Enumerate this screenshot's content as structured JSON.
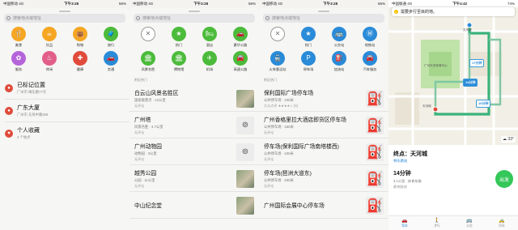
{
  "panel1": {
    "status": {
      "left": "中国移动 4G",
      "time": "下午3:28",
      "right": "56%"
    },
    "search_placeholder": "搜索地点或地址",
    "categories": [
      {
        "label": "美食",
        "icon": "fork-knife-icon",
        "glyph": "🍴",
        "color": "#f5a623"
      },
      {
        "label": "饮品",
        "icon": "coffee-cup-icon",
        "glyph": "☕",
        "color": "#f5a623"
      },
      {
        "label": "购物",
        "icon": "shopping-bag-icon",
        "glyph": "👜",
        "color": "#f5a623"
      },
      {
        "label": "旅行",
        "icon": "suitcase-icon",
        "glyph": "🧳",
        "color": "#4cbb3b"
      },
      {
        "label": "服务",
        "icon": "service-icon",
        "glyph": "✿",
        "color": "#b565d9"
      },
      {
        "label": "休闲",
        "icon": "leisure-icon",
        "glyph": "♨",
        "color": "#e25f8a"
      },
      {
        "label": "健康",
        "icon": "health-icon",
        "glyph": "✚",
        "color": "#e04b3b"
      },
      {
        "label": "交通",
        "icon": "transit-icon",
        "glyph": "🚗",
        "color": "#2a8bd8"
      }
    ],
    "favorites": [
      {
        "title": "已标记位置",
        "subtitle": "广州市 梅东路77号",
        "icon": "pin-icon",
        "glyph": "●"
      },
      {
        "title": "广东大厦",
        "subtitle": "广州市 东风中路309",
        "icon": "pin-icon",
        "glyph": "●"
      },
      {
        "title": "个人收藏",
        "subtitle": "2 个地点",
        "icon": "heart-icon",
        "glyph": "♥"
      }
    ]
  },
  "panel2": {
    "status": {
      "left": "中国移动 4G",
      "time": "下午3:28",
      "right": "56%"
    },
    "search_placeholder": "搜索地点或地址",
    "categories": [
      {
        "label": "",
        "icon": "close-icon",
        "glyph": "✕",
        "color": "#4cbb3b",
        "outline": true
      },
      {
        "label": "热门",
        "icon": "star-icon",
        "glyph": "★",
        "color": "#4cbb3b"
      },
      {
        "label": "酒店",
        "icon": "bed-icon",
        "glyph": "🛏",
        "color": "#4cbb3b"
      },
      {
        "label": "豪华公路",
        "icon": "car-icon",
        "glyph": "🚗",
        "color": "#4cbb3b"
      },
      {
        "label": "风景名胜",
        "icon": "landmark-icon",
        "glyph": "🏛",
        "color": "#4cbb3b"
      },
      {
        "label": "博物馆",
        "icon": "museum-icon",
        "glyph": "🏛",
        "color": "#4cbb3b"
      },
      {
        "label": "机场",
        "icon": "airplane-icon",
        "glyph": "✈",
        "color": "#4cbb3b"
      },
      {
        "label": "高速公路",
        "icon": "highway-icon",
        "glyph": "🚘",
        "color": "#4cbb3b"
      }
    ],
    "section_title": "附近热门",
    "results": [
      {
        "title": "白云山风景名胜区",
        "subtitle": "国家级景点 · 12公里",
        "rating": "无评论",
        "thumb": "photo"
      },
      {
        "title": "广州塔",
        "subtitle": "风景名胜 · 4.7公里",
        "rating": "无评论",
        "thumb": "bino"
      },
      {
        "title": "广州动物园",
        "subtitle": "动物园 · 3公里",
        "rating": "无评论",
        "thumb": "bino"
      },
      {
        "title": "越秀公园",
        "subtitle": "公园 · 11公里",
        "rating": "无评论",
        "thumb": "photo"
      },
      {
        "title": "中山纪念堂",
        "subtitle": "",
        "rating": "",
        "thumb": "photo"
      }
    ]
  },
  "panel3": {
    "status": {
      "left": "中国移动 4G",
      "time": "下午3:28",
      "right": "56%"
    },
    "search_placeholder": "搜索地点或地址",
    "categories": [
      {
        "label": "",
        "icon": "close-icon",
        "glyph": "✕",
        "color": "#2a8bd8",
        "outline": true
      },
      {
        "label": "热门",
        "icon": "star-icon",
        "glyph": "★",
        "color": "#2a8bd8"
      },
      {
        "label": "公交站",
        "icon": "bus-icon",
        "glyph": "🚌",
        "color": "#2a8bd8"
      },
      {
        "label": "地铁站",
        "icon": "metro-icon",
        "glyph": "Ⓜ",
        "color": "#2a8bd8"
      },
      {
        "label": "火车客运站",
        "icon": "train-icon",
        "glyph": "🚆",
        "color": "#2a8bd8"
      },
      {
        "label": "停车场",
        "icon": "parking-icon",
        "glyph": "P",
        "color": "#2a8bd8"
      },
      {
        "label": "加油站",
        "icon": "fuel-icon",
        "glyph": "⛽",
        "color": "#2a8bd8"
      },
      {
        "label": "汽车服务",
        "icon": "car-service-icon",
        "glyph": "🚘",
        "color": "#2a8bd8"
      }
    ],
    "section_title": "附近热门",
    "results": [
      {
        "title": "保利国际广场停车场",
        "subtitle": "公共停车场 · 100米",
        "rating": "大众点评 ★★★★☆ (6)",
        "thumb": "fuel"
      },
      {
        "title": "广州香格里拉大酒店即货区停车场",
        "subtitle": "公共停车场 · 150米",
        "rating": "无评论",
        "thumb": "fuel"
      },
      {
        "title": "停车场(保利国际广场南塔楼西)",
        "subtitle": "公共停车场 · 100米",
        "rating": "无评论",
        "thumb": "fuel"
      },
      {
        "title": "停车场(琶洲大道东)",
        "subtitle": "公共停车场 · 250米",
        "rating": "无评论",
        "thumb": "fuel"
      },
      {
        "title": "广州国际会展中心停车场",
        "subtitle": "",
        "rating": "",
        "thumb": "fuel"
      }
    ]
  },
  "panel4": {
    "status": {
      "left": "中国联通 4G",
      "time": "下午4:42",
      "right": "74%"
    },
    "banner": "需要步行至目的地。",
    "map_labels": [
      "天河城",
      "广州天河体育中心",
      "天河城",
      "17分钟",
      "14分钟",
      "16分钟"
    ],
    "weather": "☁ 33°",
    "destination": {
      "title": "终点：天河城",
      "subtitle": "林乐路站"
    },
    "route": {
      "duration": "14分钟",
      "detail": "3.1公里 · 体育东路",
      "toll": "最快路线",
      "go": "出发"
    },
    "tabs": [
      {
        "label": "驾车",
        "icon": "car-icon",
        "glyph": "🚗",
        "active": true
      },
      {
        "label": "步行",
        "icon": "walk-icon",
        "glyph": "🚶",
        "active": false
      },
      {
        "label": "公交",
        "icon": "bus-icon",
        "glyph": "🚌",
        "active": false
      },
      {
        "label": "叫车",
        "icon": "taxi-icon",
        "glyph": "🚕",
        "active": false
      }
    ]
  }
}
